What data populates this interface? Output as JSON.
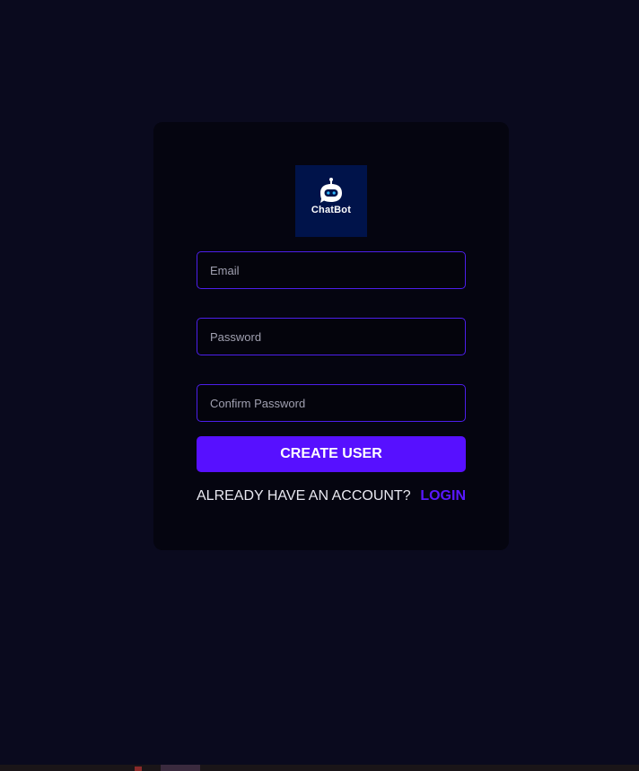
{
  "logo": {
    "text": "ChatBot",
    "icon": "robot-icon"
  },
  "form": {
    "email_placeholder": "Email",
    "password_placeholder": "Password",
    "confirm_placeholder": "Confirm Password",
    "submit_label": "CREATE USER"
  },
  "footer": {
    "question": "ALREADY HAVE AN ACCOUNT?",
    "login_label": "LOGIN"
  },
  "colors": {
    "background": "#0a0a1e",
    "card": "#050510",
    "accent": "#5710ff",
    "logo_bg": "#00134a"
  }
}
